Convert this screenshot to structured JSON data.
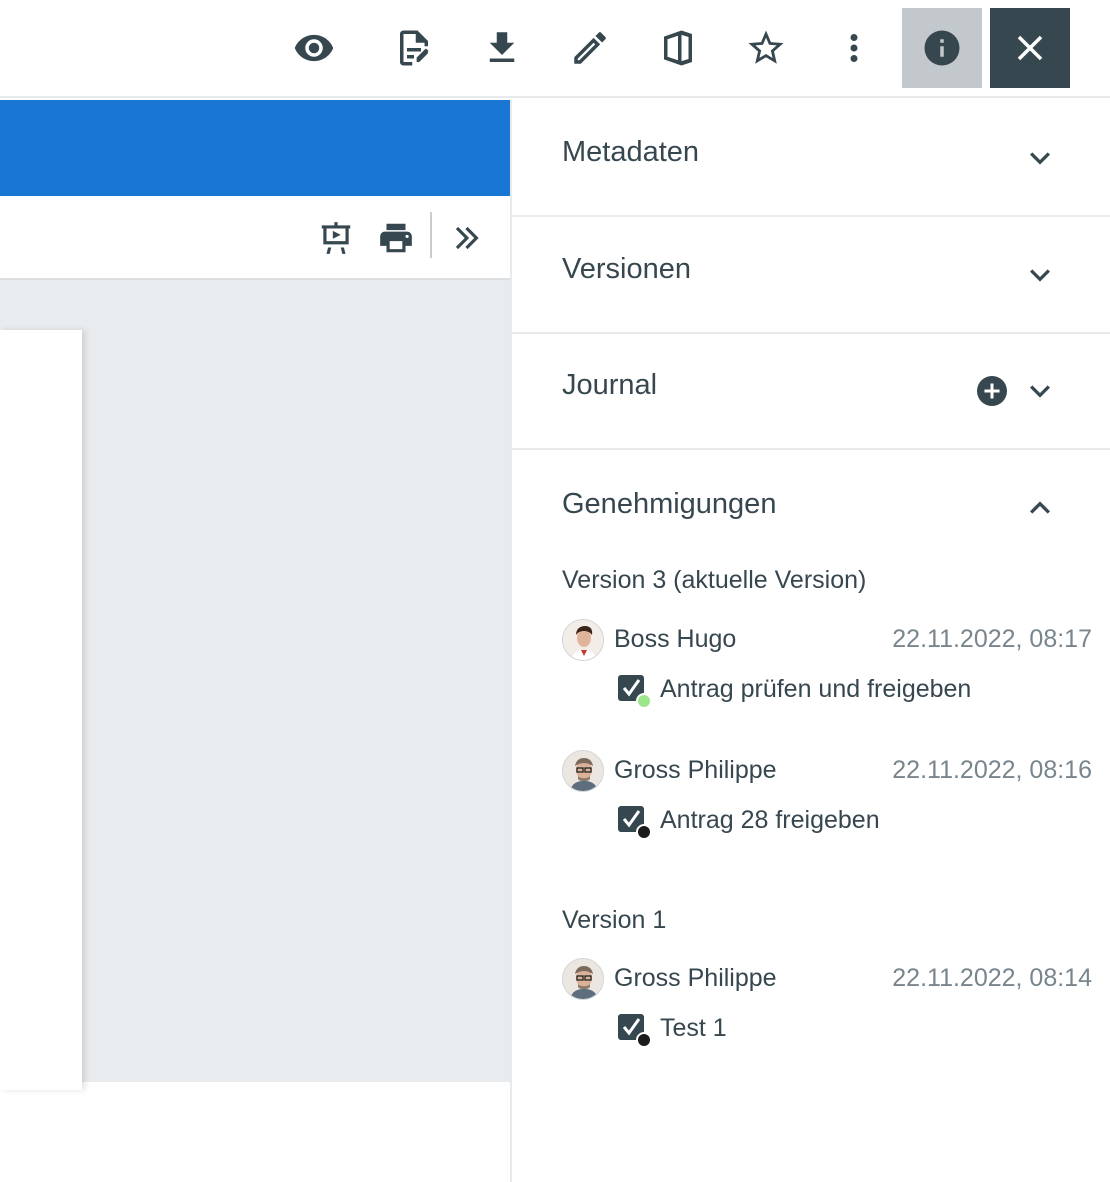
{
  "toolbar": {
    "icons": [
      "eye-icon",
      "edit-document-icon",
      "download-icon",
      "pencil-icon",
      "office-icon",
      "star-icon",
      "more-vert-icon",
      "info-icon",
      "close-icon"
    ]
  },
  "viewer": {
    "tools": [
      "presentation-icon",
      "print-icon",
      "double-chevron-right-icon"
    ],
    "accent_color": "#1976d2"
  },
  "panel": {
    "sections": [
      {
        "title": "Metadaten",
        "expanded": false
      },
      {
        "title": "Versionen",
        "expanded": false
      },
      {
        "title": "Journal",
        "expanded": false
      },
      {
        "title": "Genehmigungen",
        "expanded": true
      }
    ],
    "approvals": {
      "version3": {
        "label": "Version 3 (aktuelle Version)",
        "entries": [
          {
            "user": "Boss Hugo",
            "timestamp": "22.11.2022, 08:17",
            "task": "Antrag prüfen und freigeben",
            "status_color": "#9be68a"
          },
          {
            "user": "Gross Philippe",
            "timestamp": "22.11.2022, 08:16",
            "task": "Antrag 28 freigeben",
            "status_color": "#1b1b1b"
          }
        ]
      },
      "version1": {
        "label": "Version 1",
        "entries": [
          {
            "user": "Gross Philippe",
            "timestamp": "22.11.2022, 08:14",
            "task": "Test 1",
            "status_color": "#1b1b1b"
          }
        ]
      }
    }
  }
}
